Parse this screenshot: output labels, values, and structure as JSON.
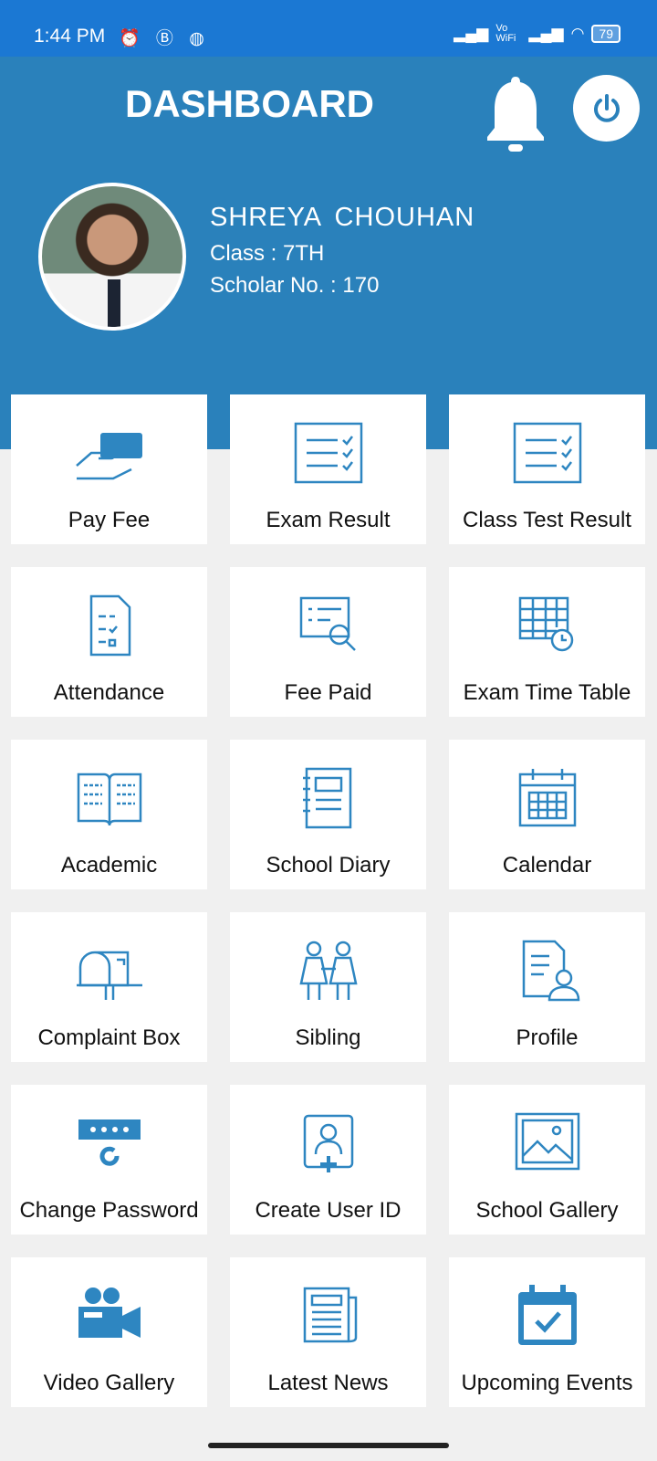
{
  "status_bar": {
    "time": "1:44 PM",
    "battery": "79",
    "network": "Vo WiFi"
  },
  "header": {
    "title": "DASHBOARD"
  },
  "student": {
    "name": "SHREYA  CHOUHAN",
    "class": "Class : 7TH",
    "scholar_no": "Scholar No. : 170"
  },
  "colors": {
    "status_bar": "#1b78d3",
    "header": "#2a81bb",
    "icon": "#2e86c1"
  },
  "tiles": [
    {
      "label": "Pay Fee",
      "icon": "card-hand-icon"
    },
    {
      "label": "Exam Result",
      "icon": "checklist-icon"
    },
    {
      "label": "Class Test Result",
      "icon": "checklist-icon"
    },
    {
      "label": "Attendance",
      "icon": "attendance-sheet-icon"
    },
    {
      "label": "Fee Paid",
      "icon": "receipt-search-icon"
    },
    {
      "label": "Exam Time Table",
      "icon": "timetable-clock-icon"
    },
    {
      "label": "Academic",
      "icon": "open-book-icon"
    },
    {
      "label": "School Diary",
      "icon": "notebook-icon"
    },
    {
      "label": "Calendar",
      "icon": "calendar-icon"
    },
    {
      "label": "Complaint Box",
      "icon": "mailbox-icon"
    },
    {
      "label": "Sibling",
      "icon": "siblings-icon"
    },
    {
      "label": "Profile",
      "icon": "profile-document-icon"
    },
    {
      "label": "Change Password",
      "icon": "password-reset-icon"
    },
    {
      "label": "Create User ID",
      "icon": "add-user-icon"
    },
    {
      "label": "School Gallery",
      "icon": "image-gallery-icon"
    },
    {
      "label": "Video Gallery",
      "icon": "video-camera-icon"
    },
    {
      "label": "Latest News",
      "icon": "newspaper-icon"
    },
    {
      "label": "Upcoming Events",
      "icon": "calendar-check-icon"
    }
  ]
}
